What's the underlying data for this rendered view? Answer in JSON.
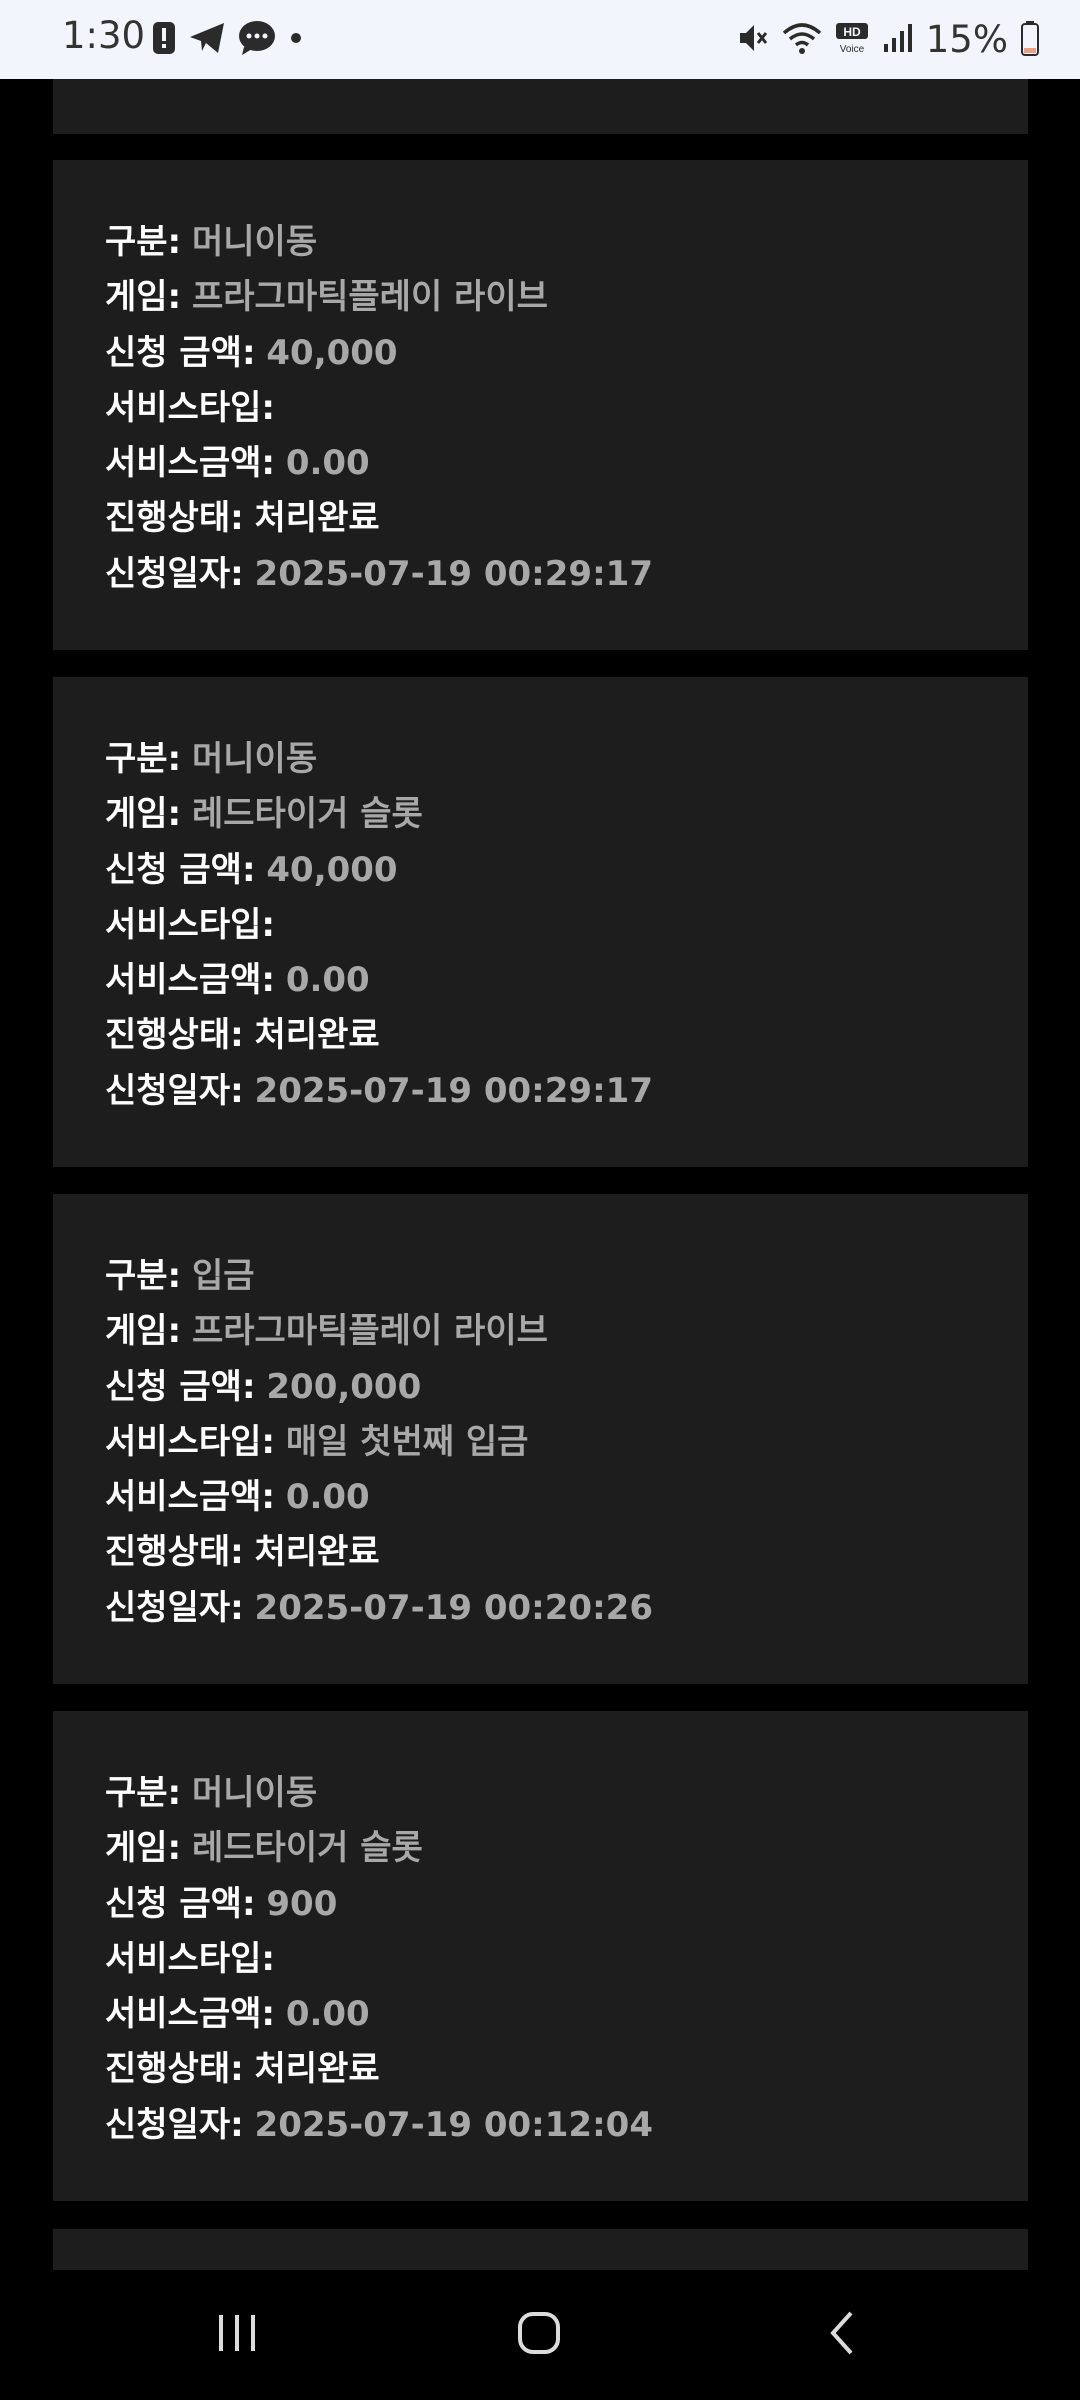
{
  "status_bar": {
    "time": "1:30",
    "battery": "15%",
    "left_icons": [
      "alert-icon",
      "telegram-icon",
      "chat-icon",
      "dot-icon"
    ],
    "right_icons": [
      "mute-icon",
      "wifi-icon",
      "hd-voice-icon",
      "signal-icon",
      "battery-icon"
    ],
    "battery_color": "#f0a080"
  },
  "labels": {
    "category": "구분:",
    "game": "게임:",
    "amount": "신청 금액:",
    "service_type": "서비스타입:",
    "service_amount": "서비스금액:",
    "progress": "진행상태:",
    "date": "신청일자:"
  },
  "cards": [
    {
      "category": "머니이동",
      "game": "프라그마틱플레이 라이브",
      "amount": "40,000",
      "service_type": "",
      "service_amount": "0.00",
      "progress": "처리완료",
      "date": "2025-07-19 00:29:17"
    },
    {
      "category": "머니이동",
      "game": "레드타이거 슬롯",
      "amount": "40,000",
      "service_type": "",
      "service_amount": "0.00",
      "progress": "처리완료",
      "date": "2025-07-19 00:29:17"
    },
    {
      "category": "입금",
      "game": "프라그마틱플레이 라이브",
      "amount": "200,000",
      "service_type": "매일 첫번째 입금",
      "service_amount": "0.00",
      "progress": "처리완료",
      "date": "2025-07-19 00:20:26"
    },
    {
      "category": "머니이동",
      "game": "레드타이거 슬롯",
      "amount": "900",
      "service_type": "",
      "service_amount": "0.00",
      "progress": "처리완료",
      "date": "2025-07-19 00:12:04"
    }
  ],
  "nav": {
    "recents": "recents-icon",
    "home": "home-icon",
    "back": "back-icon"
  }
}
